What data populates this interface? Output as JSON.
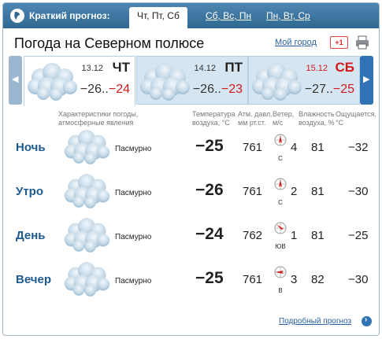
{
  "topbar": {
    "brand": "Краткий прогноз:",
    "tabs": [
      "Чт, Пт, Сб",
      "Сб, Вс, Пн",
      "Пн, Вт, Ср"
    ]
  },
  "title": "Погода на Северном полюсе",
  "my_city": "Мой город",
  "gplus": "+1",
  "days": [
    {
      "date": "13.12",
      "dow": "ЧТ",
      "min": "−26..",
      "max": "−24",
      "weekend": false
    },
    {
      "date": "14.12",
      "dow": "ПТ",
      "min": "−26..",
      "max": "−23",
      "weekend": false
    },
    {
      "date": "15.12",
      "dow": "СБ",
      "min": "−27..",
      "max": "−25",
      "weekend": true
    }
  ],
  "headers": {
    "conditions": [
      "Характеристики погоды,",
      "атмосферные явления"
    ],
    "temp": [
      "Температура",
      "воздуха, °С"
    ],
    "pressure": [
      "Атм. давл.",
      "мм рт.ст."
    ],
    "wind": [
      "Ветер,",
      "м/с"
    ],
    "humidity": [
      "Влажность",
      "воздуха, %"
    ],
    "feels": [
      "Ощущается,",
      "°С"
    ]
  },
  "rows": [
    {
      "part": "Ночь",
      "cond": "Пасмурно",
      "temp": "−25",
      "press": "761",
      "wdir": "С",
      "wspd": "4",
      "hum": "81",
      "feel": "−32"
    },
    {
      "part": "Утро",
      "cond": "Пасмурно",
      "temp": "−26",
      "press": "761",
      "wdir": "С",
      "wspd": "2",
      "hum": "81",
      "feel": "−30"
    },
    {
      "part": "День",
      "cond": "Пасмурно",
      "temp": "−24",
      "press": "762",
      "wdir": "ЮВ",
      "wspd": "1",
      "hum": "81",
      "feel": "−25"
    },
    {
      "part": "Вечер",
      "cond": "Пасмурно",
      "temp": "−25",
      "press": "761",
      "wdir": "В",
      "wspd": "3",
      "hum": "82",
      "feel": "−30"
    }
  ],
  "more_link": "Подробный прогноз",
  "icons": {
    "cloud": "overcast-cloud-icon",
    "wind": "wind-direction-icon",
    "print": "printer-icon",
    "logo": "logo-icon"
  }
}
